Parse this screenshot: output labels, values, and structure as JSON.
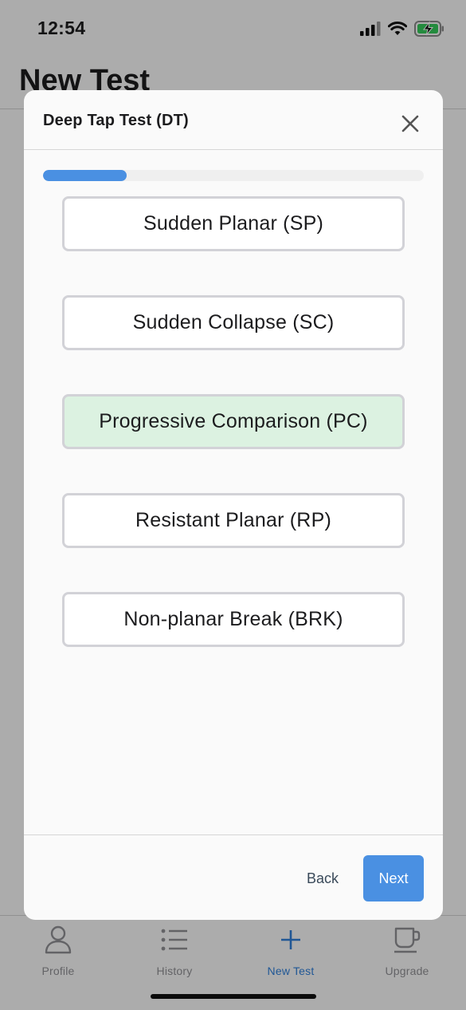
{
  "status_bar": {
    "time": "12:54",
    "icons": [
      "cellular-signal-icon",
      "wifi-icon",
      "battery-charging-icon"
    ]
  },
  "page": {
    "title": "New Test"
  },
  "modal": {
    "title": "Deep Tap Test (DT)",
    "close_icon": "close-icon",
    "progress": 0.22,
    "options": [
      {
        "label": "Sudden Planar (SP)",
        "selected": false
      },
      {
        "label": "Sudden Collapse (SC)",
        "selected": false
      },
      {
        "label": "Progressive Comparison (PC)",
        "selected": true
      },
      {
        "label": "Resistant Planar (RP)",
        "selected": false
      },
      {
        "label": "Non-planar Break (BRK)",
        "selected": false
      }
    ],
    "back_label": "Back",
    "next_label": "Next"
  },
  "tab_bar": {
    "tabs": [
      {
        "label": "Profile",
        "icon": "person-icon",
        "active": false
      },
      {
        "label": "History",
        "icon": "list-icon",
        "active": false
      },
      {
        "label": "New Test",
        "icon": "plus-icon",
        "active": true
      },
      {
        "label": "Upgrade",
        "icon": "coffee-cup-icon",
        "active": false
      }
    ]
  },
  "colors": {
    "accent": "#4a90e2",
    "active_tab": "#2f7dd6",
    "selected_option_bg": "#dcf2e1",
    "battery_charge": "#34c759"
  }
}
